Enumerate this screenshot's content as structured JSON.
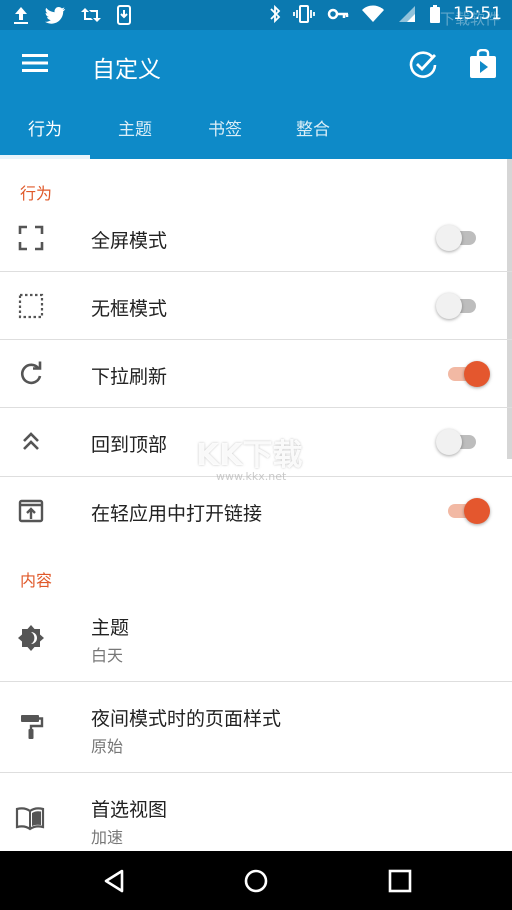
{
  "status_bar": {
    "time": "15:51",
    "left_icons": [
      "upload-icon",
      "twitter-icon",
      "retweet-icon",
      "phone-download-icon"
    ],
    "right_icons": [
      "bluetooth-icon",
      "vibrate-icon",
      "key-icon",
      "wifi-icon",
      "signal-icon",
      "battery-icon"
    ],
    "corner_watermark": "下载软件"
  },
  "app_bar": {
    "title": "自定义",
    "menu_icon": "hamburger-menu-icon",
    "actions": [
      "check-circle-icon",
      "play-store-icon"
    ]
  },
  "tabs": [
    {
      "label": "行为",
      "active": true
    },
    {
      "label": "主题",
      "active": false
    },
    {
      "label": "书签",
      "active": false
    },
    {
      "label": "整合",
      "active": false
    }
  ],
  "sections": [
    {
      "header": "行为",
      "items": [
        {
          "label": "全屏模式",
          "icon": "fullscreen-icon",
          "switch": false
        },
        {
          "label": "无框模式",
          "icon": "dotted-frame-icon",
          "switch": false
        },
        {
          "label": "下拉刷新",
          "icon": "refresh-icon",
          "switch": true
        },
        {
          "label": "回到顶部",
          "icon": "double-chevron-up-icon",
          "switch": false
        },
        {
          "label": "在轻应用中打开链接",
          "icon": "open-in-app-icon",
          "switch": true
        }
      ]
    },
    {
      "header": "内容",
      "items": [
        {
          "label": "主题",
          "sub": "白天",
          "icon": "brightness-icon"
        },
        {
          "label": "夜间模式时的页面样式",
          "sub": "原始",
          "icon": "paint-roller-icon"
        },
        {
          "label": "首选视图",
          "sub": "加速",
          "icon": "book-open-icon"
        }
      ]
    }
  ],
  "watermark": {
    "text": "KK下载",
    "url": "www.kkx.net"
  },
  "colors": {
    "status_bar": "#0b79b0",
    "app_bar": "#0e8ac8",
    "accent": "#e4572e",
    "section_header": "#e0592a"
  },
  "nav_bar": {
    "buttons": [
      "back-icon",
      "home-icon",
      "recents-icon"
    ]
  }
}
